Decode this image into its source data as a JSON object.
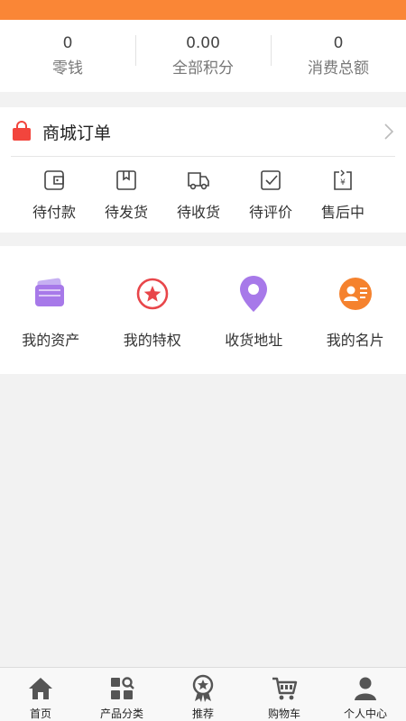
{
  "colors": {
    "accent": "#fa8636",
    "order_red": "#f2453d",
    "purple": "#a779e9",
    "star_red": "#e8464a",
    "orange": "#f5822e"
  },
  "stats": [
    {
      "value": "0",
      "label": "零钱"
    },
    {
      "value": "0.00",
      "label": "全部积分"
    },
    {
      "value": "0",
      "label": "消费总额"
    }
  ],
  "orders": {
    "title": "商城订单",
    "tabs": [
      {
        "label": "待付款",
        "icon": "wallet-icon"
      },
      {
        "label": "待发货",
        "icon": "package-icon"
      },
      {
        "label": "待收货",
        "icon": "truck-icon"
      },
      {
        "label": "待评价",
        "icon": "check-box-icon"
      },
      {
        "label": "售后中",
        "icon": "refund-icon"
      }
    ]
  },
  "tools": [
    {
      "label": "我的资产",
      "icon": "purse-icon"
    },
    {
      "label": "我的特权",
      "icon": "star-badge-icon"
    },
    {
      "label": "收货地址",
      "icon": "location-pin-icon"
    },
    {
      "label": "我的名片",
      "icon": "profile-card-icon"
    }
  ],
  "nav": [
    {
      "label": "首页",
      "icon": "home-icon"
    },
    {
      "label": "产品分类",
      "icon": "category-icon"
    },
    {
      "label": "推荐",
      "icon": "award-icon"
    },
    {
      "label": "购物车",
      "icon": "cart-icon"
    },
    {
      "label": "个人中心",
      "icon": "user-icon"
    }
  ]
}
